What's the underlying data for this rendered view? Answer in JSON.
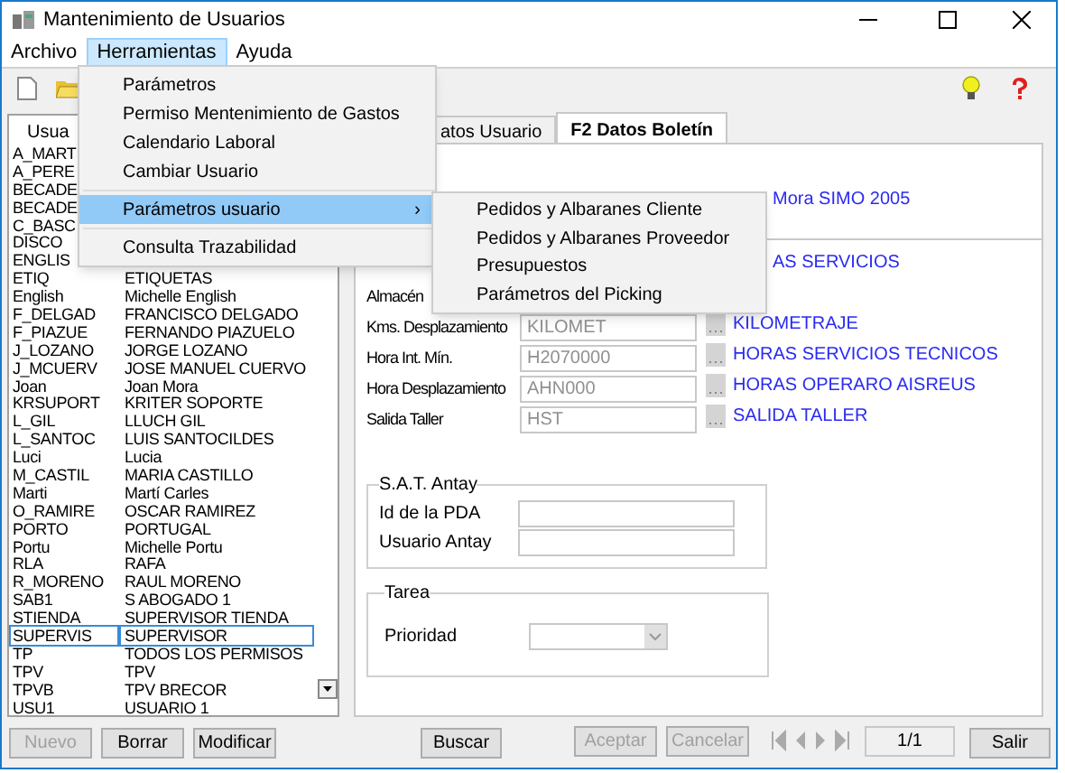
{
  "window": {
    "title": "Mantenimiento de Usuarios"
  },
  "menu_bar": [
    {
      "label": "Archivo",
      "selected": false
    },
    {
      "label": "Herramientas",
      "selected": true
    },
    {
      "label": "Ayuda",
      "selected": false
    }
  ],
  "tools_menu": [
    {
      "kind": "item",
      "label": "Parámetros",
      "selected": false
    },
    {
      "kind": "item",
      "label": "Permiso Mentenimiento de Gastos",
      "selected": false
    },
    {
      "kind": "item",
      "label": "Calendario Laboral",
      "selected": false
    },
    {
      "kind": "item",
      "label": "Cambiar Usuario",
      "selected": false
    },
    {
      "kind": "separator"
    },
    {
      "kind": "submenu",
      "label": "Parámetros usuario",
      "arrow": "›",
      "selected": true
    },
    {
      "kind": "separator"
    },
    {
      "kind": "item",
      "label": "Consulta Trazabilidad",
      "selected": false
    }
  ],
  "submenu": [
    "Pedidos y Albaranes Cliente",
    "Pedidos y Albaranes Proveedor",
    "Presupuestos",
    "Parámetros del Picking"
  ],
  "user_list": {
    "header": "Usua",
    "rows": [
      {
        "code": "A_MART",
        "selected": false
      },
      {
        "code": "A_PERE",
        "selected": false
      },
      {
        "code": "BECADE",
        "selected": false
      },
      {
        "code": "BECADE",
        "selected": false
      },
      {
        "code": "C_BASC",
        "selected": false
      },
      {
        "code": "DISCO",
        "selected": false
      },
      {
        "code": "ENGLIS",
        "selected": false
      },
      {
        "code": "ETIQ",
        "name": "ETIQUETAS",
        "selected": false
      },
      {
        "code": "English",
        "name": "Michelle English",
        "selected": false
      },
      {
        "code": "F_DELGAD",
        "name": "FRANCISCO DELGADO",
        "selected": false
      },
      {
        "code": "F_PIAZUE",
        "name": "FERNANDO PIAZUELO",
        "selected": false
      },
      {
        "code": "J_LOZANO",
        "name": "JORGE LOZANO",
        "selected": false
      },
      {
        "code": "J_MCUERV",
        "name": "JOSE MANUEL CUERVO",
        "selected": false
      },
      {
        "code": "Joan",
        "name": "Joan Mora",
        "selected": false
      },
      {
        "code": "KRSUPORT",
        "name": "KRITER SOPORTE",
        "selected": false
      },
      {
        "code": "L_GIL",
        "name": "LLUCH GIL",
        "selected": false
      },
      {
        "code": "L_SANTOC",
        "name": "LUIS SANTOCILDES",
        "selected": false
      },
      {
        "code": "Luci",
        "name": "Lucia",
        "selected": false
      },
      {
        "code": "M_CASTIL",
        "name": "MARIA CASTILLO",
        "selected": false
      },
      {
        "code": "Marti",
        "name": "Martí Carles",
        "selected": false
      },
      {
        "code": "O_RAMIRE",
        "name": "OSCAR RAMIREZ",
        "selected": false
      },
      {
        "code": "PORTO",
        "name": "PORTUGAL",
        "selected": false
      },
      {
        "code": "Portu",
        "name": "Michelle Portu",
        "selected": false
      },
      {
        "code": "RLA",
        "name": "RAFA",
        "selected": false
      },
      {
        "code": "R_MORENO",
        "name": "RAUL MORENO",
        "selected": false
      },
      {
        "code": "SAB1",
        "name": "S ABOGADO 1",
        "selected": false
      },
      {
        "code": "STIENDA",
        "name": "SUPERVISOR TIENDA",
        "selected": false
      },
      {
        "code": "SUPERVIS",
        "name": "SUPERVISOR",
        "selected": true
      },
      {
        "code": "TP",
        "name": "TODOS LOS PERMISOS",
        "selected": false
      },
      {
        "code": "TPV",
        "name": "TPV",
        "selected": false
      },
      {
        "code": "TPVB",
        "name": "TPV BRECOR",
        "selected": false
      },
      {
        "code": "USU1",
        "name": "USUARIO 1",
        "selected": false
      }
    ]
  },
  "tabs": [
    {
      "label": "atos Usuario",
      "selected": false
    },
    {
      "label": "F2 Datos Boletín",
      "selected": true
    }
  ],
  "top_rows": [
    {
      "link": "Mora SIMO 2005"
    }
  ],
  "rows": [
    {
      "link": "AS SERVICIOS"
    },
    {
      "label": "Almacén"
    },
    {
      "label": "Kms. Desplazamiento",
      "value": "KILOMET",
      "link": "KILOMETRAJE"
    },
    {
      "label": "Hora Int. Mín.",
      "value": "H2070000",
      "link": "HORAS SERVICIOS TECNICOS"
    },
    {
      "label": "Hora Desplazamiento",
      "value": "AHN000",
      "link": "HORAS OPERARO AISREUS"
    },
    {
      "label": "Salida Taller",
      "value": "HST",
      "link": "SALIDA TALLER"
    }
  ],
  "sat_group": {
    "title": "S.A.T. Antay",
    "fields": [
      "Id de la PDA",
      "Usuario Antay"
    ]
  },
  "task_group": {
    "title": "Tarea",
    "field": "Prioridad"
  },
  "buttons_left": [
    {
      "label": "Nuevo",
      "disabled": true
    },
    {
      "label": "Borrar",
      "disabled": false
    },
    {
      "label": "Modificar",
      "disabled": false
    }
  ],
  "search_button": {
    "label": "Buscar",
    "disabled": false
  },
  "buttons_mid": [
    {
      "label": "Aceptar",
      "disabled": true
    },
    {
      "label": "Cancelar",
      "disabled": true
    }
  ],
  "record_counter": "1/1",
  "exit_button": {
    "label": "Salir",
    "disabled": false
  }
}
